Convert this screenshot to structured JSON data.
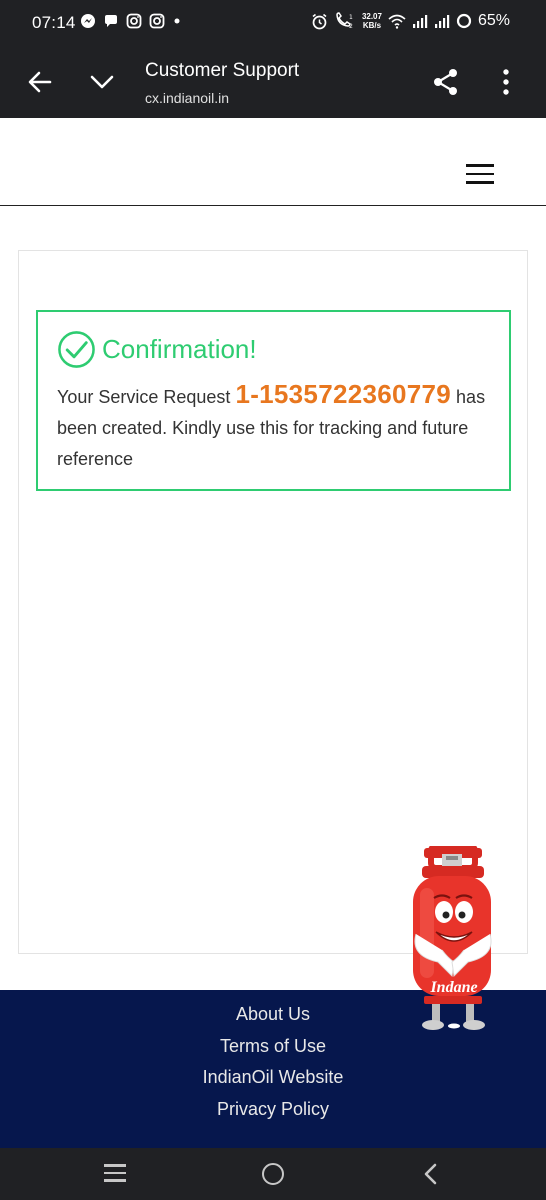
{
  "status_bar": {
    "time": "07:14",
    "notification_icons": [
      "messenger-icon",
      "chat-bubble-icon",
      "instagram-icon",
      "instagram-icon",
      "dot-icon"
    ],
    "speed_value": "32.07",
    "speed_unit": "KB/s",
    "battery": "65%"
  },
  "toolbar": {
    "title": "Customer Support",
    "url": "cx.indianoil.in"
  },
  "confirmation": {
    "title": "Confirmation!",
    "message_prefix": "Your Service Request ",
    "request_number": "1-1535722360779",
    "message_suffix": " has been created. Kindly use this for tracking and future reference"
  },
  "mascot": {
    "brand": "Indane"
  },
  "footer": {
    "links": [
      "About Us",
      "Terms of Use",
      "IndianOil Website",
      "Privacy Policy"
    ]
  },
  "colors": {
    "success_green": "#2ecc71",
    "request_orange": "#e8771f",
    "footer_navy": "#06174d",
    "chrome_dark": "#202124",
    "mascot_red": "#e8342b"
  }
}
